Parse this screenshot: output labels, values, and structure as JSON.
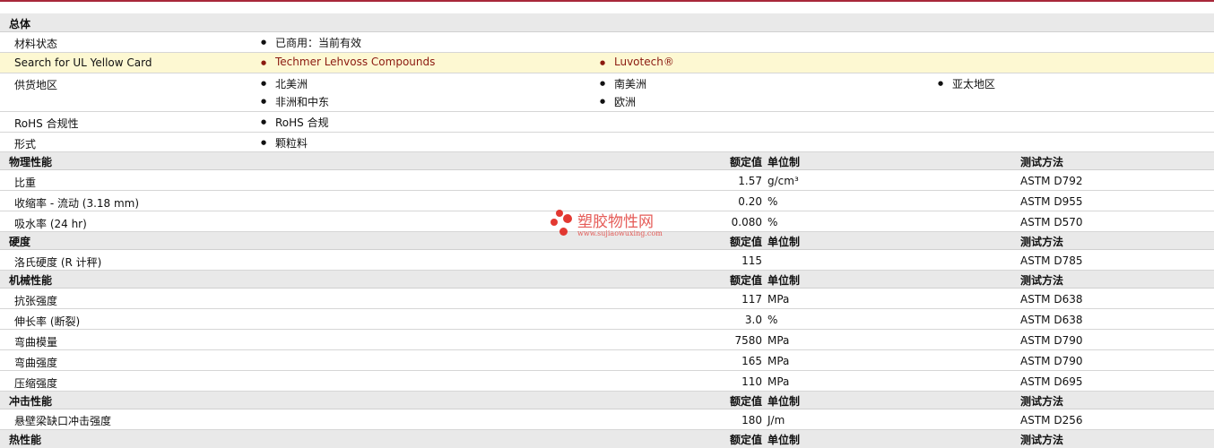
{
  "general": {
    "title": "总体",
    "material_status": {
      "label": "材料状态",
      "value": "已商用：当前有效"
    },
    "ul_search": {
      "label": "Search for UL Yellow Card",
      "links": [
        "Techmer Lehvoss Compounds",
        "Luvotech®"
      ]
    },
    "availability": {
      "label": "供货地区",
      "regions": [
        "北美洲",
        "南美洲",
        "亚太地区",
        "非洲和中东",
        "欧洲"
      ]
    },
    "rohs": {
      "label": "RoHS 合规性",
      "value": "RoHS 合规"
    },
    "form": {
      "label": "形式",
      "value": "颗粒料"
    }
  },
  "column_headers": {
    "nominal": "额定值",
    "unit": "单位制",
    "method": "测试方法"
  },
  "sections": [
    {
      "title": "物理性能",
      "rows": [
        {
          "name": "比重",
          "value": "1.57",
          "unit": "g/cm³",
          "method": "ASTM D792"
        },
        {
          "name": "收缩率  - 流动  (3.18 mm)",
          "value": "0.20",
          "unit": "%",
          "method": "ASTM D955"
        },
        {
          "name": "吸水率  (24 hr)",
          "value": "0.080",
          "unit": "%",
          "method": "ASTM D570"
        }
      ]
    },
    {
      "title": "硬度",
      "rows": [
        {
          "name": "洛氏硬度  (R 计秤)",
          "value": "115",
          "unit": "",
          "method": "ASTM D785"
        }
      ]
    },
    {
      "title": "机械性能",
      "rows": [
        {
          "name": "抗张强度",
          "value": "117",
          "unit": "MPa",
          "method": "ASTM D638"
        },
        {
          "name": "伸长率  (断裂)",
          "value": "3.0",
          "unit": "%",
          "method": "ASTM D638"
        },
        {
          "name": "弯曲模量",
          "value": "7580",
          "unit": "MPa",
          "method": "ASTM D790"
        },
        {
          "name": "弯曲强度",
          "value": "165",
          "unit": "MPa",
          "method": "ASTM D790"
        },
        {
          "name": "压缩强度",
          "value": "110",
          "unit": "MPa",
          "method": "ASTM D695"
        }
      ]
    },
    {
      "title": "冲击性能",
      "rows": [
        {
          "name": "悬壁梁缺口冲击强度",
          "value": "180",
          "unit": "J/m",
          "method": "ASTM D256"
        }
      ]
    },
    {
      "title": "热性能",
      "rows": []
    }
  ],
  "watermark": {
    "name": "塑胶物性网",
    "url": "www.sujiaowuxing.com",
    "color": "#e0241c"
  }
}
